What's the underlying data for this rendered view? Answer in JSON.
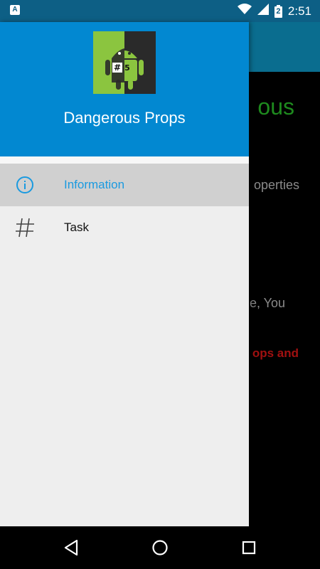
{
  "status_bar": {
    "time": "2:51",
    "notification_icon": "A",
    "battery_label": "2",
    "icons": [
      "wifi-icon",
      "signal-icon",
      "battery-icon"
    ]
  },
  "background_content": {
    "title_fragment": "ous",
    "line1_fragment": "operties",
    "line2_fragment": "e, You",
    "line3_fragment": "ops and"
  },
  "drawer": {
    "title": "Dangerous Props",
    "header_color": "#0288d1",
    "items": [
      {
        "label": "Information",
        "icon": "info-icon",
        "selected": true,
        "color": "#1a9ae0"
      },
      {
        "label": "Task",
        "icon": "hashtag-icon",
        "selected": false,
        "color": "#111111"
      }
    ]
  },
  "nav_bar": {
    "buttons": [
      "back-icon",
      "home-icon",
      "recents-icon"
    ]
  }
}
